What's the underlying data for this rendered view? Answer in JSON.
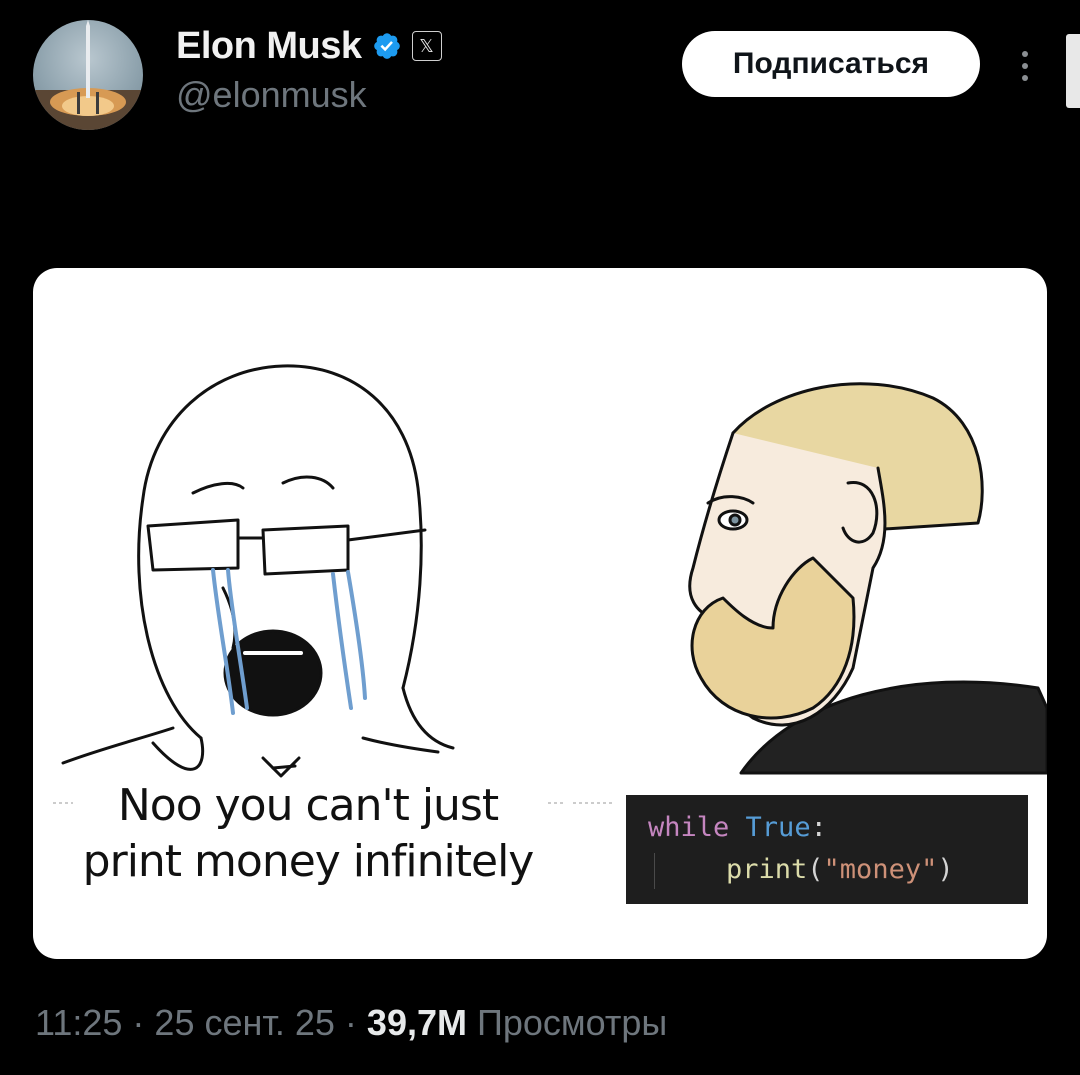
{
  "author": {
    "name": "Elon Musk",
    "handle": "@elonmusk",
    "verified": true,
    "affiliate_badge": "𝕏",
    "avatar": "rocket-launch-avatar"
  },
  "follow_label": "Подписаться",
  "more_icon": "more-vertical-icon",
  "media": {
    "left_caption_line1": "Noo you can't just",
    "left_caption_line2": "print money infinitely",
    "code": {
      "line1_keyword": "while",
      "line1_value": "True",
      "line1_colon": ":",
      "line2_func": "print",
      "line2_open": "(",
      "line2_string": "\"money\"",
      "line2_close": ")"
    }
  },
  "meta": {
    "time": "11:25",
    "sep1": " · ",
    "date": "25 сент. 25",
    "sep2": " · ",
    "views_count": "39,7M",
    "views_label": " Просмотры"
  },
  "colors": {
    "background": "#000000",
    "verified_blue": "#1d9bf0",
    "muted_text": "#6e767d"
  }
}
